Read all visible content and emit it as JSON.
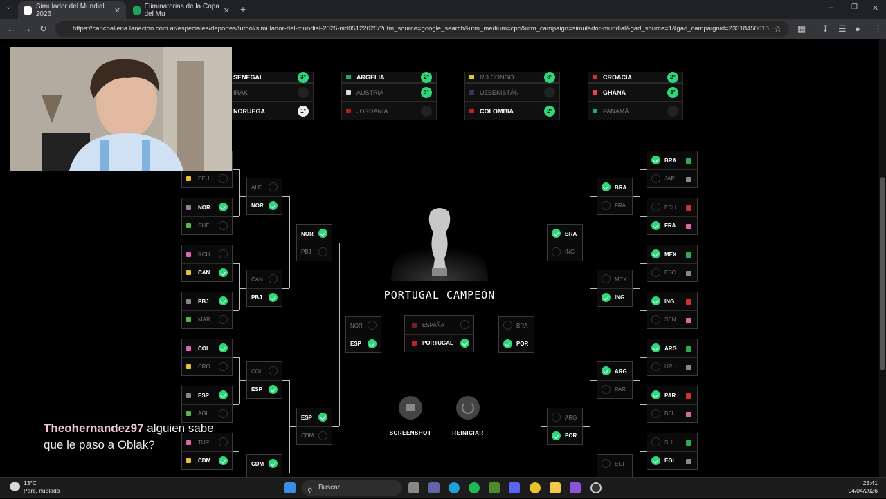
{
  "browser": {
    "tabs": [
      {
        "label": "Simulador del Mundial 2026",
        "active": true
      },
      {
        "label": "Eliminatorias de la Copa del Mu",
        "active": false
      }
    ],
    "new_tab": "+",
    "url": "https://canchallena.lanacion.com.ar/especiales/deportes/futbol/simulador-del-mundial-2026-nid05122025/?utm_source=google_search&utm_medium=cpc&utm_campaign=simulador-mundial&gad_source=1&gad_campaignid=23318450618..."
  },
  "groups": [
    {
      "rows": [
        {
          "name": "SENEGAL",
          "pos": "3°",
          "sel": true,
          "partial": true
        },
        {
          "name": "IRAK",
          "pos": "",
          "sel": false
        },
        {
          "name": "NORUEGA",
          "pos": "1°",
          "sel": true
        }
      ]
    },
    {
      "rows": [
        {
          "name": "ARGELIA",
          "pos": "2°",
          "sel": true,
          "partial": true
        },
        {
          "name": "AUSTRIA",
          "pos": "3°",
          "sel": false
        },
        {
          "name": "JORDANIA",
          "pos": "",
          "sel": false
        }
      ]
    },
    {
      "rows": [
        {
          "name": "RD CONGO",
          "pos": "3°",
          "sel": false,
          "partial": true
        },
        {
          "name": "UZBEKISTÁN",
          "pos": "",
          "sel": false
        },
        {
          "name": "COLOMBIA",
          "pos": "2°",
          "sel": true
        }
      ]
    },
    {
      "rows": [
        {
          "name": "CROACIA",
          "pos": "2°",
          "sel": true,
          "partial": true
        },
        {
          "name": "GHANA",
          "pos": "3°",
          "sel": true
        },
        {
          "name": "PANAMÁ",
          "pos": "",
          "sel": false
        }
      ]
    }
  ],
  "left_r32": [
    {
      "a": "",
      "b": "EEUU",
      "wa": false,
      "wb": false
    },
    {
      "a": "NOR",
      "b": "SUE",
      "wa": true,
      "wb": false
    },
    {
      "a": "RCH",
      "b": "CAN",
      "wa": false,
      "wb": true
    },
    {
      "a": "PBJ",
      "b": "MAR",
      "wa": true,
      "wb": false
    },
    {
      "a": "COL",
      "b": "CRO",
      "wa": true,
      "wb": false
    },
    {
      "a": "ESP",
      "b": "AGL",
      "wa": true,
      "wb": false
    },
    {
      "a": "TUR",
      "b": "CDM",
      "wa": false,
      "wb": true
    }
  ],
  "left_r16": [
    {
      "a": "ALE",
      "b": "NOR",
      "wa": false,
      "wb": true
    },
    {
      "a": "CAN",
      "b": "PBJ",
      "wa": false,
      "wb": true
    },
    {
      "a": "COL",
      "b": "ESP",
      "wa": false,
      "wb": true
    },
    {
      "a": "CDM",
      "b": "",
      "wa": true,
      "wb": false
    }
  ],
  "left_qf": [
    {
      "a": "NOR",
      "b": "PBJ",
      "wa": true,
      "wb": false
    },
    {
      "a": "ESP",
      "b": "CDM",
      "wa": true,
      "wb": false
    }
  ],
  "left_sf": {
    "a": "NOR",
    "b": "ESP",
    "wa": false,
    "wb": true
  },
  "right_r32": [
    {
      "a": "BRA",
      "b": "JAP",
      "wa": true,
      "wb": false
    },
    {
      "a": "ECU",
      "b": "FRA",
      "wa": false,
      "wb": true
    },
    {
      "a": "MEX",
      "b": "ESC",
      "wa": true,
      "wb": false
    },
    {
      "a": "ING",
      "b": "SEN",
      "wa": true,
      "wb": false
    },
    {
      "a": "ARG",
      "b": "URU",
      "wa": true,
      "wb": false
    },
    {
      "a": "PAR",
      "b": "BEL",
      "wa": true,
      "wb": false
    },
    {
      "a": "SUI",
      "b": "EGI",
      "wa": false,
      "wb": true
    }
  ],
  "right_r16": [
    {
      "a": "BRA",
      "b": "FRA",
      "wa": true,
      "wb": false
    },
    {
      "a": "MEX",
      "b": "ING",
      "wa": false,
      "wb": true
    },
    {
      "a": "ARG",
      "b": "PAR",
      "wa": true,
      "wb": false
    },
    {
      "a": "EGI",
      "b": "",
      "wa": false,
      "wb": false
    }
  ],
  "right_qf": [
    {
      "a": "BRA",
      "b": "ING",
      "wa": true,
      "wb": false
    },
    {
      "a": "ARG",
      "b": "POR",
      "wa": false,
      "wb": true
    }
  ],
  "right_sf": {
    "a": "BRA",
    "b": "POR",
    "wa": false,
    "wb": true
  },
  "final": {
    "a": "ESPAÑA",
    "b": "PORTUGAL",
    "wa": false,
    "wb": true
  },
  "champion": "PORTUGAL CAMPEÓN",
  "actions": {
    "screenshot": "SCREENSHOT",
    "reset": "REINICIAR"
  },
  "chat": {
    "user": "Theohernandez97",
    "message": " alguien sabe que le paso a Oblak?"
  },
  "taskbar": {
    "temp": "13°C",
    "weather": "Parc. nublado",
    "search": "Buscar",
    "time": "23:41",
    "date": "04/04/2026"
  },
  "colors": {
    "check": "#2fd67a",
    "background": "#000000"
  }
}
